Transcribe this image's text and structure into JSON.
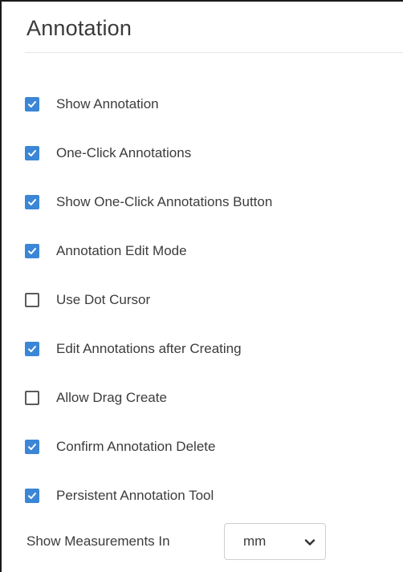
{
  "panel": {
    "title": "Annotation"
  },
  "options": [
    {
      "label": "Show Annotation",
      "checked": true
    },
    {
      "label": "One-Click Annotations",
      "checked": true
    },
    {
      "label": "Show One-Click Annotations Button",
      "checked": true
    },
    {
      "label": "Annotation Edit Mode",
      "checked": true
    },
    {
      "label": "Use Dot Cursor",
      "checked": false
    },
    {
      "label": "Edit Annotations after Creating",
      "checked": true
    },
    {
      "label": "Allow Drag Create",
      "checked": false
    },
    {
      "label": "Confirm Annotation Delete",
      "checked": true
    },
    {
      "label": "Persistent Annotation Tool",
      "checked": true
    }
  ],
  "measurements": {
    "label": "Show Measurements In",
    "selected": "mm",
    "icon": "chevron-down-icon"
  },
  "colors": {
    "checkbox_checked": "#3b86d6",
    "checkbox_border": "#5a5a5a",
    "text": "#3c3c3c"
  }
}
